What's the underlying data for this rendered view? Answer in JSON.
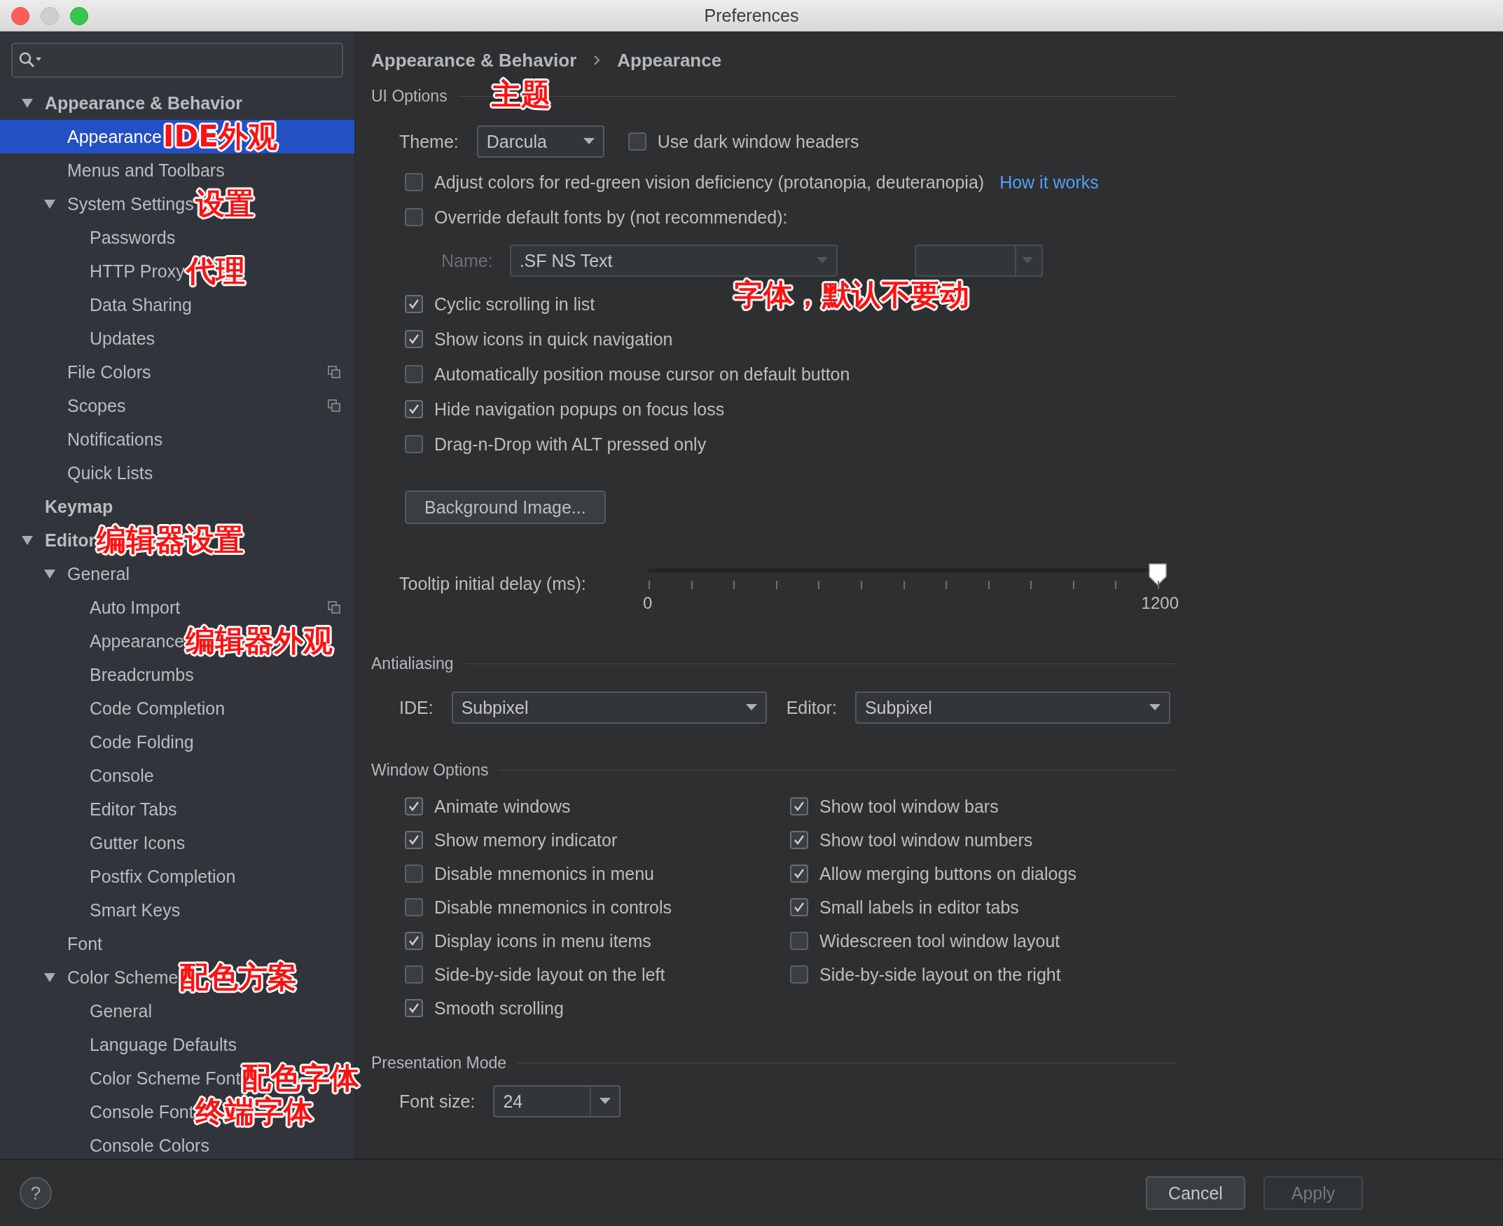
{
  "window": {
    "title": "Preferences"
  },
  "sidebar": {
    "items": [
      {
        "label": "Appearance & Behavior",
        "selected": false,
        "expanded": true,
        "children": [
          {
            "label": "Appearance",
            "selected": true,
            "note": "IDE外观"
          },
          {
            "label": "Menus and Toolbars",
            "selected": false
          },
          {
            "label": "System Settings",
            "selected": false,
            "expanded": true,
            "note": "设置",
            "children": [
              {
                "label": "Passwords",
                "selected": false
              },
              {
                "label": "HTTP Proxy",
                "selected": false,
                "note": "代理"
              },
              {
                "label": "Data Sharing",
                "selected": false
              },
              {
                "label": "Updates",
                "selected": false
              }
            ]
          },
          {
            "label": "File Colors",
            "selected": false,
            "scoped": true
          },
          {
            "label": "Scopes",
            "selected": false,
            "scoped": true
          },
          {
            "label": "Notifications",
            "selected": false
          },
          {
            "label": "Quick Lists",
            "selected": false
          }
        ]
      },
      {
        "label": "Keymap",
        "selected": false
      },
      {
        "label": "Editor",
        "selected": false,
        "expanded": true,
        "note": "编辑器设置",
        "children": [
          {
            "label": "General",
            "selected": false,
            "expanded": true,
            "children": [
              {
                "label": "Auto Import",
                "selected": false,
                "scoped": true
              },
              {
                "label": "Appearance",
                "selected": false,
                "note": "编辑器外观"
              },
              {
                "label": "Breadcrumbs",
                "selected": false
              },
              {
                "label": "Code Completion",
                "selected": false
              },
              {
                "label": "Code Folding",
                "selected": false
              },
              {
                "label": "Console",
                "selected": false
              },
              {
                "label": "Editor Tabs",
                "selected": false
              },
              {
                "label": "Gutter Icons",
                "selected": false
              },
              {
                "label": "Postfix Completion",
                "selected": false
              },
              {
                "label": "Smart Keys",
                "selected": false
              }
            ]
          },
          {
            "label": "Font",
            "selected": false
          },
          {
            "label": "Color Scheme",
            "selected": false,
            "expanded": true,
            "note": "配色方案",
            "children": [
              {
                "label": "General",
                "selected": false
              },
              {
                "label": "Language Defaults",
                "selected": false
              },
              {
                "label": "Color Scheme Font",
                "selected": false,
                "note": "配色字体"
              },
              {
                "label": "Console Font",
                "selected": false,
                "note": "终端字体"
              },
              {
                "label": "Console Colors",
                "selected": false
              }
            ]
          }
        ]
      }
    ]
  },
  "breadcrumb": [
    "Appearance & Behavior",
    "Appearance"
  ],
  "ui_options": {
    "title": "UI Options",
    "note": "主题",
    "theme": {
      "label": "Theme:",
      "value": "Darcula"
    },
    "dark_headers": {
      "label": "Use dark window headers",
      "checked": false
    },
    "options": [
      {
        "kind": "checkbox",
        "label": "Adjust colors for red-green vision deficiency (protanopia, deuteranopia)",
        "checked": false,
        "link": "How it works"
      },
      {
        "kind": "checkbox",
        "label": "Override default fonts by (not recommended):",
        "checked": false
      },
      {
        "kind": "font",
        "label": "Name:",
        "value": ".SF NS Text",
        "disabled": true,
        "note": "字体，默认不要动"
      },
      {
        "kind": "checkbox",
        "label": "Cyclic scrolling in list",
        "checked": true
      },
      {
        "kind": "checkbox",
        "label": "Show icons in quick navigation",
        "checked": true
      },
      {
        "kind": "checkbox",
        "label": "Automatically position mouse cursor on default button",
        "checked": false
      },
      {
        "kind": "checkbox",
        "label": "Hide navigation popups on focus loss",
        "checked": true
      },
      {
        "kind": "checkbox",
        "label": "Drag-n-Drop with ALT pressed only",
        "checked": false
      },
      {
        "kind": "button",
        "label": "Background Image..."
      },
      {
        "kind": "slider",
        "label": "Tooltip initial delay (ms):",
        "level": 1.0,
        "min": "0",
        "max": "1200"
      }
    ]
  },
  "antialiasing": {
    "title": "Antialiasing",
    "ide": {
      "label": "IDE:",
      "value": "Subpixel"
    },
    "editor": {
      "label": "Editor:",
      "value": "Subpixel"
    }
  },
  "window_options": {
    "title": "Window Options",
    "items": [
      {
        "label": "Animate windows",
        "checked": true
      },
      {
        "label": "Show tool window bars",
        "checked": true
      },
      {
        "label": "Show memory indicator",
        "checked": true
      },
      {
        "label": "Show tool window numbers",
        "checked": true
      },
      {
        "label": "Disable mnemonics in menu",
        "checked": false
      },
      {
        "label": "Allow merging buttons on dialogs",
        "checked": true
      },
      {
        "label": "Disable mnemonics in controls",
        "checked": false
      },
      {
        "label": "Small labels in editor tabs",
        "checked": true
      },
      {
        "label": "Display icons in menu items",
        "checked": true
      },
      {
        "label": "Widescreen tool window layout",
        "checked": false
      },
      {
        "label": "Side-by-side layout on the left",
        "checked": false
      },
      {
        "label": "Side-by-side layout on the right",
        "checked": false
      },
      {
        "label": "Smooth scrolling",
        "checked": true
      }
    ]
  },
  "presentation_mode": {
    "title": "Presentation Mode",
    "font_size": {
      "label": "Font size:",
      "value": "24"
    }
  },
  "footer": {
    "help": "?",
    "buttons": [
      {
        "label": "Cancel",
        "disabled": false
      },
      {
        "label": "Apply",
        "disabled": true
      }
    ]
  }
}
